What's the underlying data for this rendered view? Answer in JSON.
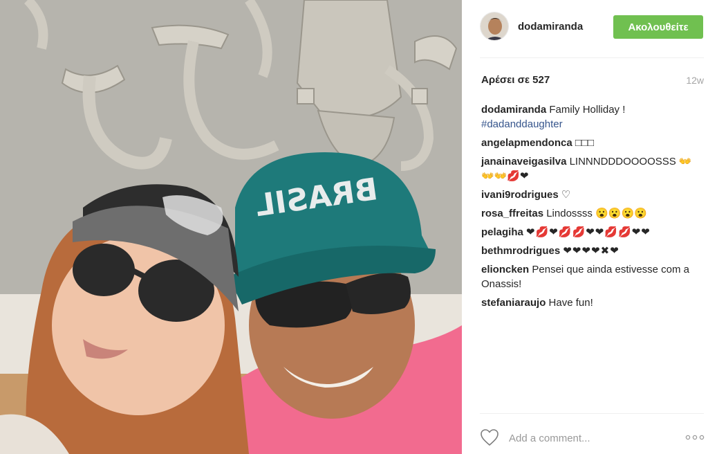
{
  "post": {
    "username": "dodamiranda",
    "follow_label": "Ακολουθείτε",
    "likes": "Αρέσει σε 527",
    "age": "12w",
    "photo_cap_text": "BRASIL",
    "comments": [
      {
        "user": "dodamiranda",
        "text": "Family Holliday !",
        "hashtag": "#dadanddaughter"
      },
      {
        "user": "angelapmendonca",
        "text": "□□□"
      },
      {
        "user": "janainaveigasilva",
        "text": "LINNNDDDOOOOSSS 👐👐👐💋❤"
      },
      {
        "user": "ivani9rodrigues",
        "text": "♡"
      },
      {
        "user": "rosa_ffreitas",
        "text": "Lindossss 😮😮😮😮"
      },
      {
        "user": "pelagiha",
        "text": "❤💋❤💋💋❤❤💋💋❤❤"
      },
      {
        "user": "bethmrodrigues",
        "text": "❤❤❤❤✖❤"
      },
      {
        "user": "elioncken",
        "text": "Pensei que ainda estivesse com a Onassis!"
      },
      {
        "user": "stefaniaraujo",
        "text": "Have fun!"
      }
    ],
    "comment_placeholder": "Add a comment..."
  },
  "icons": {
    "like": "heart-icon",
    "more": "more-options-icon"
  },
  "colors": {
    "follow_button": "#70c050",
    "hashtag": "#36558c",
    "muted": "#999999"
  }
}
